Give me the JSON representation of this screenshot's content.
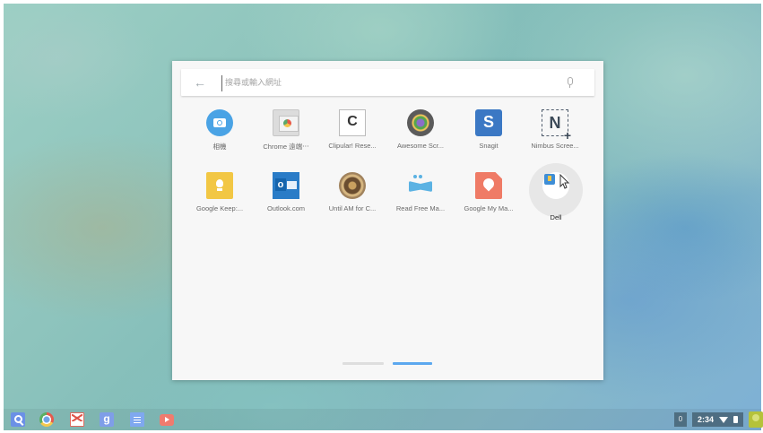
{
  "search": {
    "placeholder": "搜尋或輸入網址",
    "value": ""
  },
  "apps_row1": [
    {
      "label": "相機",
      "icon": "camera-icon"
    },
    {
      "label": "Chrome 遠端⋯",
      "icon": "chrome-remote-desktop-icon"
    },
    {
      "label": "Clipular! Rese...",
      "icon": "clipular-icon"
    },
    {
      "label": "Awesome Scr...",
      "icon": "awesome-screenshot-icon"
    },
    {
      "label": "Snagit",
      "icon": "snagit-icon"
    },
    {
      "label": "Nimbus Scree...",
      "icon": "nimbus-screenshot-icon"
    }
  ],
  "apps_row2": [
    {
      "label": "Google Keep:...",
      "icon": "google-keep-icon"
    },
    {
      "label": "Outlook.com",
      "icon": "outlook-icon"
    },
    {
      "label": "Until AM for C...",
      "icon": "until-am-icon"
    },
    {
      "label": "Read Free Ma...",
      "icon": "read-free-manga-icon"
    },
    {
      "label": "Google My Ma...",
      "icon": "google-my-maps-icon"
    },
    {
      "label": "Dell",
      "icon": "dell-icon"
    }
  ],
  "pagination": {
    "pages": 2,
    "current": 2
  },
  "shelf": {
    "apps": [
      "app-launcher-search-icon",
      "chrome-icon",
      "gmail-icon",
      "google-plus-icon",
      "google-docs-icon",
      "youtube-icon"
    ]
  },
  "tray": {
    "notification_count": "0",
    "time": "2:34",
    "wifi_icon": "wifi-icon",
    "battery_icon": "battery-icon"
  },
  "colors": {
    "accent": "#5ca8ef",
    "launcher_bg": "#f7f7f7"
  }
}
